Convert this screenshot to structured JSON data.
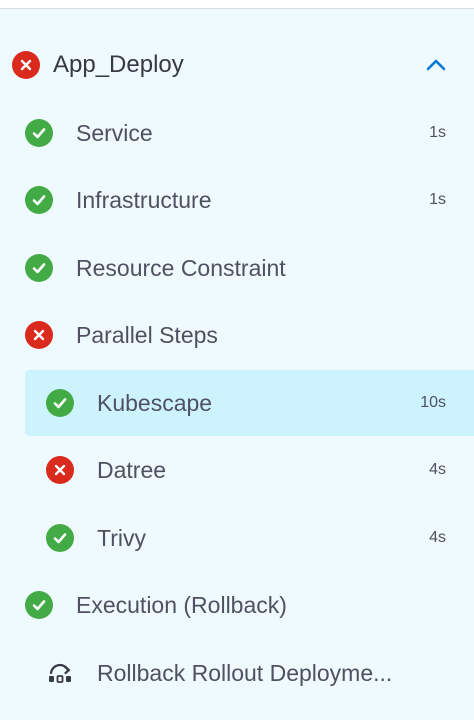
{
  "stage": {
    "name": "App_Deploy",
    "status": "failed",
    "collapse_icon": "chevron-up-icon"
  },
  "steps": [
    {
      "label": "Service",
      "status": "success",
      "duration": "1s"
    },
    {
      "label": "Infrastructure",
      "status": "success",
      "duration": "1s"
    },
    {
      "label": "Resource Constraint",
      "status": "success",
      "duration": ""
    },
    {
      "label": "Parallel Steps",
      "status": "failed",
      "duration": ""
    },
    {
      "label": "Kubescape",
      "status": "success",
      "duration": "10s",
      "selected": true
    },
    {
      "label": "Datree",
      "status": "failed",
      "duration": "4s"
    },
    {
      "label": "Trivy",
      "status": "success",
      "duration": "4s"
    },
    {
      "label": "Execution (Rollback)",
      "status": "success",
      "duration": ""
    },
    {
      "label": "Rollback Rollout Deployme...",
      "status": "rollback",
      "duration": ""
    }
  ],
  "colors": {
    "success": "#42ab45",
    "failed": "#da291d",
    "accent": "#0278d5",
    "selected_bg": "#cdf4fe",
    "background": "#eefafd"
  }
}
